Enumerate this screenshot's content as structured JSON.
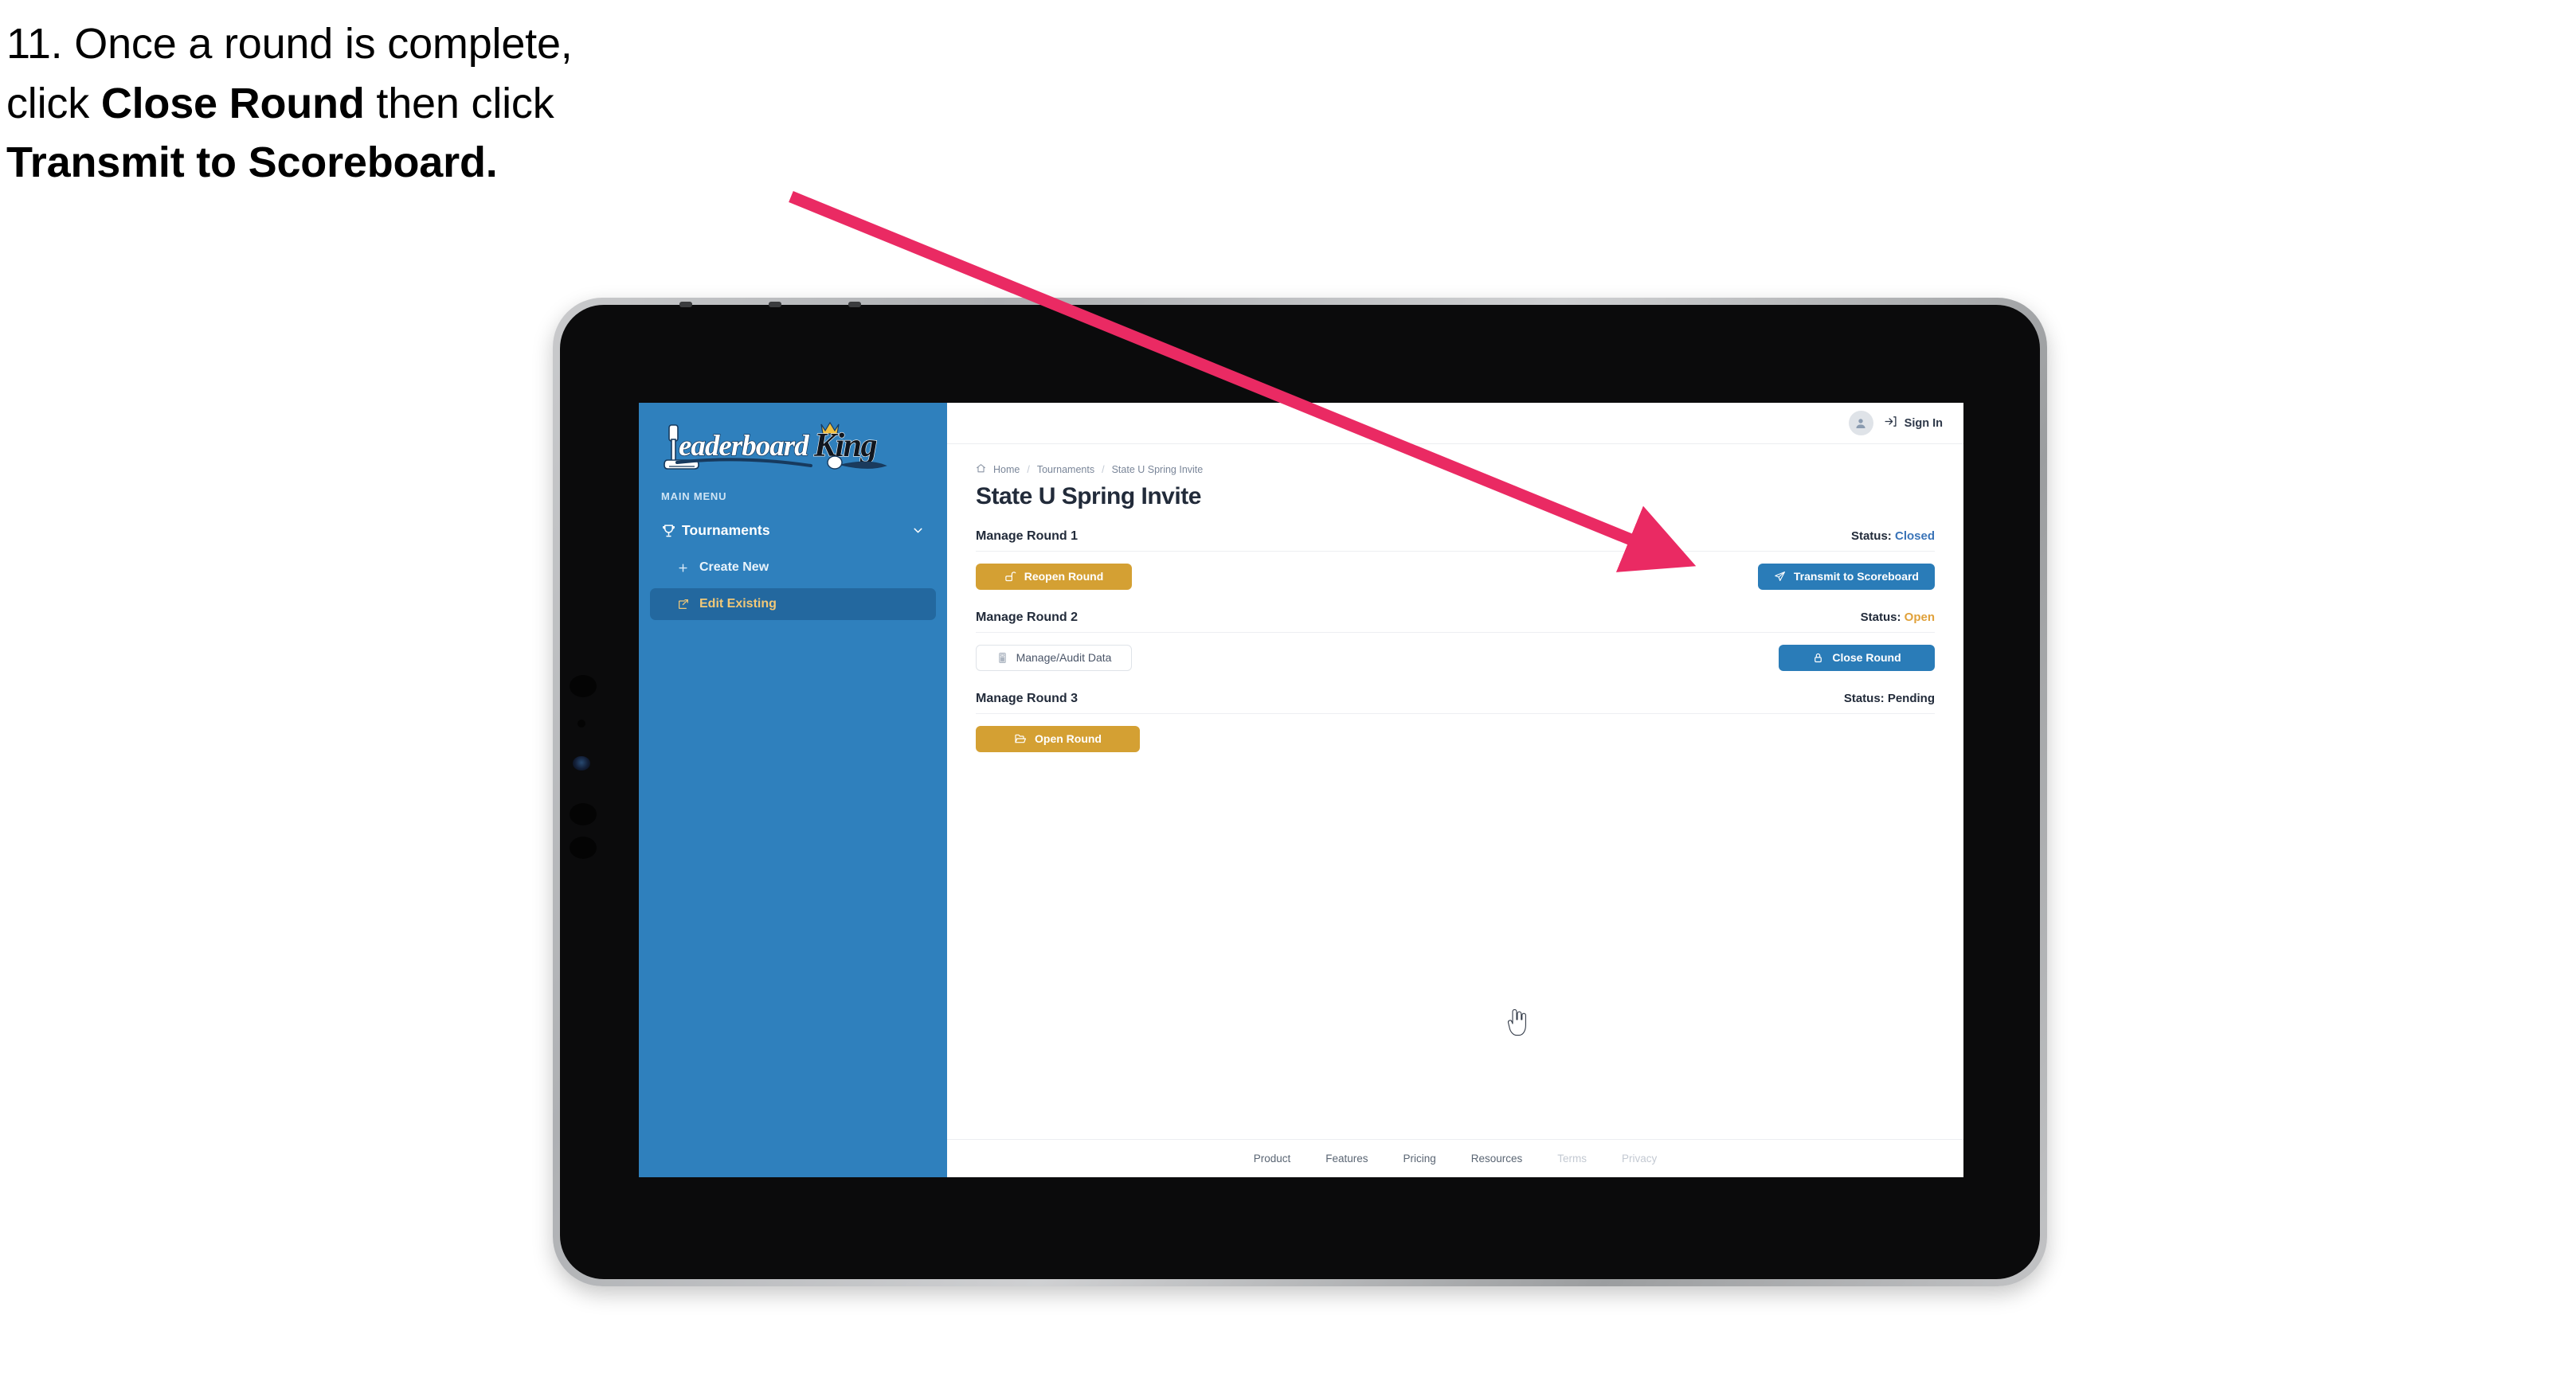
{
  "caption": {
    "line1_pre": "11. Once a round is complete,",
    "line2_pre": "click ",
    "line2_bold": "Close Round",
    "line2_post": " then click",
    "line3_bold": "Transmit to Scoreboard."
  },
  "annotation": {
    "arrow_color": "#ea2a63",
    "points_to": "Transmit to Scoreboard"
  },
  "device": {
    "type": "tablet",
    "bezel_color": "#0b0b0c",
    "frame_color": "#c2c3c5"
  },
  "sidebar": {
    "brand": {
      "word1": "Leaderboard",
      "word2": "King",
      "icon": "golf-putter-icon",
      "crown_color": "#f0c040"
    },
    "section_label": "MAIN MENU",
    "background_color": "#2f80bd",
    "active_color": "#f1c878",
    "items": [
      {
        "label": "Tournaments",
        "icon": "trophy-icon",
        "expanded": true,
        "chevron": "chevron-down-icon",
        "active": false
      },
      {
        "label": "Create New",
        "icon": "plus-icon",
        "active": false
      },
      {
        "label": "Edit Existing",
        "icon": "edit-square-icon",
        "active": true
      }
    ]
  },
  "topbar": {
    "avatar_icon": "user-avatar-icon",
    "signin_label": "Sign In",
    "signin_icon": "login-arrow-icon"
  },
  "breadcrumb": {
    "home_icon": "home-icon",
    "items": [
      "Home",
      "Tournaments",
      "State U Spring Invite"
    ],
    "separator": "/"
  },
  "page": {
    "title": "State U Spring Invite"
  },
  "rounds": [
    {
      "title": "Manage Round 1",
      "status_label": "Status:",
      "status_value": "Closed",
      "status_color": "#3a74b8",
      "left_button": {
        "label": "Reopen Round",
        "icon": "unlock-icon",
        "style": "gold"
      },
      "right_button": {
        "label": "Transmit to Scoreboard",
        "icon": "paper-plane-icon",
        "style": "blue"
      }
    },
    {
      "title": "Manage Round 2",
      "status_label": "Status:",
      "status_value": "Open",
      "status_color": "#e0a13a",
      "left_button": {
        "label": "Manage/Audit Data",
        "icon": "spreadsheet-icon",
        "style": "ghost"
      },
      "right_button": {
        "label": "Close Round",
        "icon": "lock-icon",
        "style": "blue"
      }
    },
    {
      "title": "Manage Round 3",
      "status_label": "Status:",
      "status_value": "Pending",
      "status_color": "#222b3a",
      "left_button": {
        "label": "Open Round",
        "icon": "folder-open-icon",
        "style": "gold"
      },
      "right_button": null
    }
  ],
  "footer": {
    "links": [
      {
        "label": "Product",
        "muted": false
      },
      {
        "label": "Features",
        "muted": false
      },
      {
        "label": "Pricing",
        "muted": false
      },
      {
        "label": "Resources",
        "muted": false
      },
      {
        "label": "Terms",
        "muted": true
      },
      {
        "label": "Privacy",
        "muted": true
      }
    ]
  },
  "cursor": {
    "type": "pointer-hand-cursor"
  }
}
